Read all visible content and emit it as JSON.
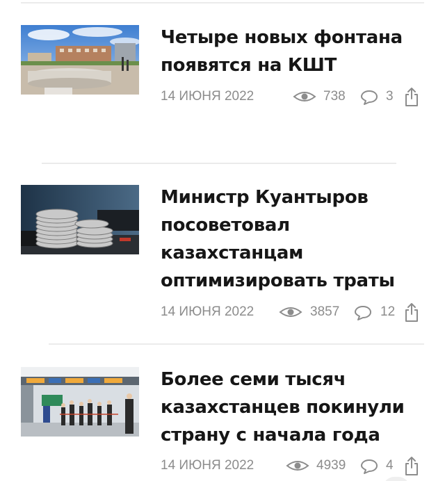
{
  "articles": [
    {
      "title_lines": [
        "Четыре новых фонтана",
        "появятся на КШТ"
      ],
      "date": "14 ИЮНЯ 2022",
      "views": "738",
      "comments": "3"
    },
    {
      "title_lines": [
        "Министр Куантыров",
        "посоветовал",
        "казахстанцам",
        "оптимизировать траты"
      ],
      "date": "14 ИЮНЯ 2022",
      "views": "3857",
      "comments": "12"
    },
    {
      "title_lines": [
        "Более семи тысяч",
        "казахстанцев покинули",
        "страну с начала года"
      ],
      "date": "14 ИЮНЯ 2022",
      "views": "4939",
      "comments": "4"
    }
  ],
  "icons": {
    "views": "eye-icon",
    "comments": "comment-bubble-icon",
    "share": "share-icon"
  },
  "colors": {
    "title": "#161616",
    "meta": "#8c8c8c",
    "divider": "#ebebeb"
  }
}
